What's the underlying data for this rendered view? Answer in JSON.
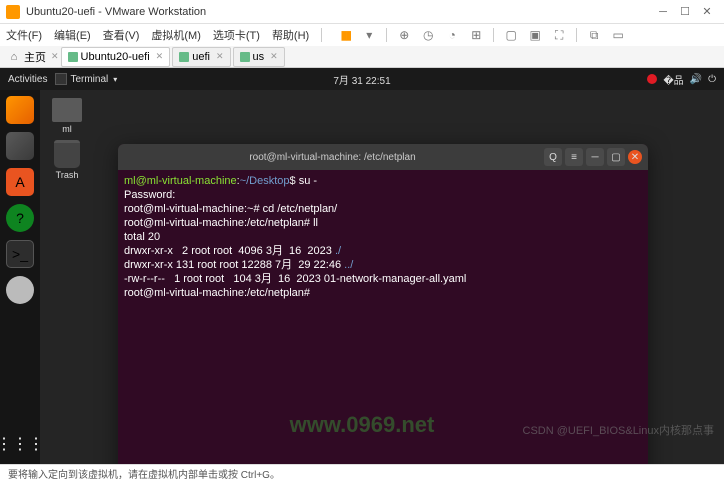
{
  "vmware": {
    "title": "Ubuntu20-uefi - VMware Workstation",
    "menus": {
      "file": "文件(F)",
      "edit": "编辑(E)",
      "view": "查看(V)",
      "vm": "虚拟机(M)",
      "tabs": "选项卡(T)",
      "help": "帮助(H)"
    },
    "tabs": {
      "home": "主页",
      "t1": "Ubuntu20-uefi",
      "t2": "uefi",
      "t3": "us"
    },
    "status": "要将输入定向到该虚拟机，请在虚拟机内部单击或按 Ctrl+G。"
  },
  "ubuntu": {
    "activities": "Activities",
    "app": "Terminal",
    "clock": "7月 31 22:51",
    "desk": {
      "ml": "ml",
      "trash": "Trash"
    }
  },
  "terminal": {
    "title": "root@ml-virtual-machine: /etc/netplan",
    "p1_user": "ml@ml-virtual-machine",
    "p1_path": "~/Desktop",
    "p1_cmd": "su -",
    "pwd": "Password:",
    "p2": "root@ml-virtual-machine:~# cd /etc/netplan/",
    "p3": "root@ml-virtual-machine:/etc/netplan# ll",
    "tot": "total 20",
    "l1": "drwxr-xr-x   2 root root  4096 3月  16  2023 ",
    "l1d": "./",
    "l2": "drwxr-xr-x 131 root root 12288 7月  29 22:46 ",
    "l2d": "../",
    "l3": "-rw-r--r--   1 root root   104 3月  16  2023 01-network-manager-all.yaml",
    "p4": "root@ml-virtual-machine:/etc/netplan# "
  },
  "watermark": {
    "url": "www.0969.net",
    "credit": "CSDN @UEFI_BIOS&Linux内核那点事"
  }
}
